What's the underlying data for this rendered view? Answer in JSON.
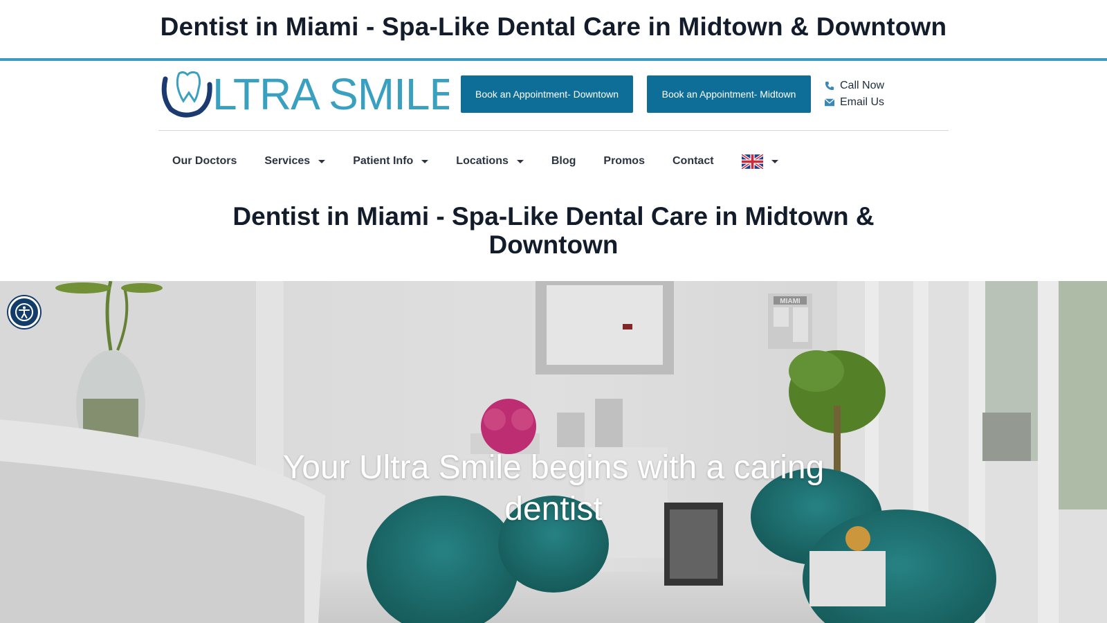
{
  "page": {
    "top_title": "Dentist in Miami - Spa-Like Dental Care in Midtown & Downtown",
    "heading": "Dentist in Miami - Spa-Like Dental Care in Midtown & Downtown"
  },
  "brand": {
    "logo_text": "LTRA SMILE",
    "logo_icon": "tooth-u-icon",
    "colors": {
      "accent": "#3d9ac0",
      "button": "#0e6e98",
      "logo_text": "#3aa0bf",
      "logo_mark": "#1b3b70",
      "heading": "#121c2a"
    }
  },
  "header": {
    "book_downtown_label": "Book an Appointment- Downtown",
    "book_midtown_label": "Book an Appointment- Midtown",
    "call_label": "Call Now",
    "call_icon": "phone-icon",
    "email_label": "Email Us",
    "email_icon": "envelope-icon"
  },
  "nav": {
    "items": [
      {
        "label": "Our Doctors",
        "has_dropdown": false
      },
      {
        "label": "Services",
        "has_dropdown": true
      },
      {
        "label": "Patient Info",
        "has_dropdown": true
      },
      {
        "label": "Locations",
        "has_dropdown": true
      },
      {
        "label": "Blog",
        "has_dropdown": false
      },
      {
        "label": "Promos",
        "has_dropdown": false
      },
      {
        "label": "Contact",
        "has_dropdown": false
      }
    ],
    "language_icon": "uk-flag-icon"
  },
  "hero": {
    "tagline": "Your Ultra Smile begins with a caring dentist",
    "sign_text": "MIAMI"
  },
  "accessibility": {
    "icon": "accessibility-icon"
  }
}
